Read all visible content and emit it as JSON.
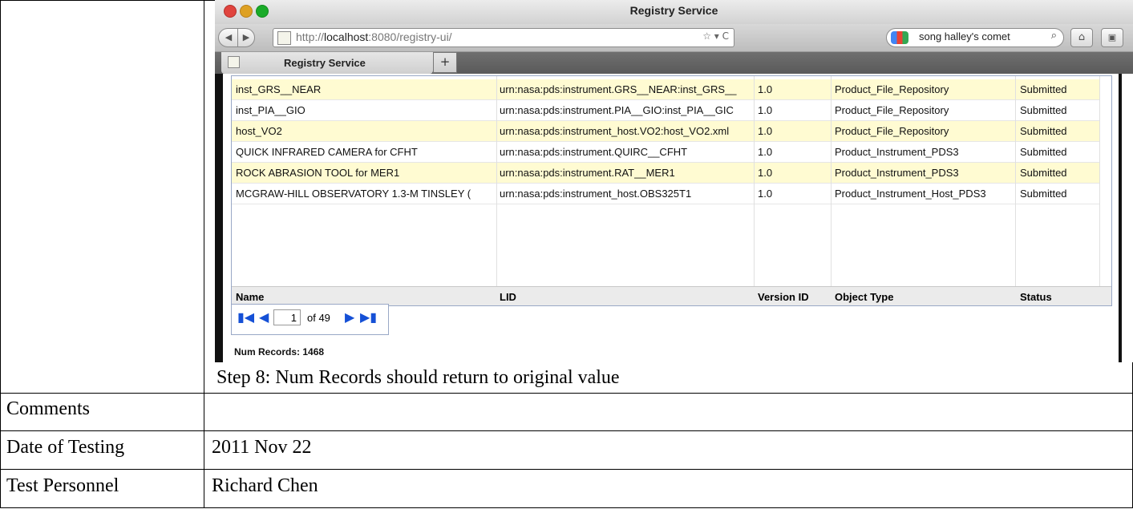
{
  "browser": {
    "window_title": "Registry Service",
    "url_host": "http://",
    "url_domain": "localhost",
    "url_rest": ":8080/registry-ui/",
    "search_query": "song halley's comet",
    "tab_label": "Registry Service",
    "new_tab_symbol": "+"
  },
  "registry": {
    "rows": [
      {
        "name": "inst_GRS__NEAR",
        "lid": "urn:nasa:pds:instrument.GRS__NEAR:inst_GRS__",
        "version": "1.0",
        "object_type": "Product_File_Repository",
        "status": "Submitted"
      },
      {
        "name": "inst_PIA__GIO",
        "lid": "urn:nasa:pds:instrument.PIA__GIO:inst_PIA__GIC",
        "version": "1.0",
        "object_type": "Product_File_Repository",
        "status": "Submitted"
      },
      {
        "name": "host_VO2",
        "lid": "urn:nasa:pds:instrument_host.VO2:host_VO2.xml",
        "version": "1.0",
        "object_type": "Product_File_Repository",
        "status": "Submitted"
      },
      {
        "name": "QUICK INFRARED CAMERA for CFHT",
        "lid": "urn:nasa:pds:instrument.QUIRC__CFHT",
        "version": "1.0",
        "object_type": "Product_Instrument_PDS3",
        "status": "Submitted"
      },
      {
        "name": "ROCK ABRASION TOOL for MER1",
        "lid": "urn:nasa:pds:instrument.RAT__MER1",
        "version": "1.0",
        "object_type": "Product_Instrument_PDS3",
        "status": "Submitted"
      },
      {
        "name": "MCGRAW-HILL OBSERVATORY 1.3-M TINSLEY (",
        "lid": "urn:nasa:pds:instrument_host.OBS325T1",
        "version": "1.0",
        "object_type": "Product_Instrument_Host_PDS3",
        "status": "Submitted"
      }
    ],
    "headers": {
      "name": "Name",
      "lid": "LID",
      "version": "Version ID",
      "object_type": "Object Type",
      "status": "Status"
    },
    "pager": {
      "current_page": "1",
      "of_text": "of 49"
    },
    "num_records": "Num Records: 1468"
  },
  "document": {
    "step_caption": "Step 8: Num Records should return to original value",
    "comments_label": "Comments",
    "comments_value": "",
    "date_label": "Date of Testing",
    "date_value": "2011 Nov 22",
    "personnel_label": "Test Personnel",
    "personnel_value": "Richard Chen"
  },
  "colors": {
    "row_highlight": "#fffbd2",
    "pager_arrow": "#1550d6",
    "close_light": "#e0443e",
    "min_light": "#dea123",
    "zoom_light": "#1aab29"
  }
}
